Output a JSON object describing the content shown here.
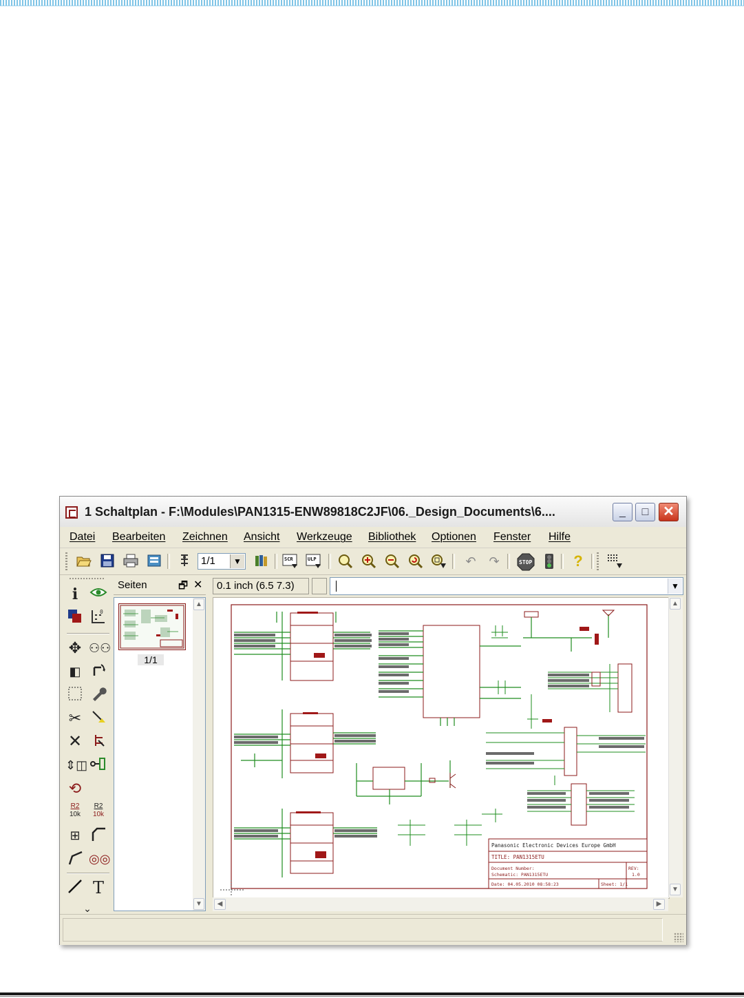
{
  "window": {
    "title": "1 Schaltplan - F:\\Modules\\PAN1315-ENW89818C2JF\\06._Design_Documents\\6....",
    "minimize": "_",
    "maximize": "□",
    "close": "✕"
  },
  "menu": [
    "Datei",
    "Bearbeiten",
    "Zeichnen",
    "Ansicht",
    "Werkzeuge",
    "Bibliothek",
    "Optionen",
    "Fenster",
    "Hilfe"
  ],
  "toolbar": {
    "sheet_value": "1/1",
    "icons": [
      "open-icon",
      "save-icon",
      "print-icon",
      "cam-icon",
      "sheet-icon",
      "library-icon",
      "script-icon",
      "ulp-icon",
      "zoom-fit-icon",
      "zoom-in-icon",
      "zoom-out-icon",
      "zoom-redraw-icon",
      "zoom-select-icon",
      "undo-icon",
      "redo-icon",
      "stop-icon",
      "go-icon",
      "help-icon",
      "grid-icon"
    ],
    "script_label": "SCR",
    "ulp_label": "ULP",
    "stop_label": "STOP",
    "help_label": "?"
  },
  "sidebar_tools": [
    "info-icon",
    "show-icon",
    "display-icon",
    "mark-icon",
    "move-icon",
    "copy-icon",
    "mirror-icon",
    "rotate-icon",
    "group-icon",
    "change-icon",
    "cut-icon",
    "paste-icon",
    "delete-icon",
    "add-icon",
    "pinswap-icon",
    "gateswap-icon",
    "replace-icon",
    "name-icon",
    "value-icon",
    "smash-icon",
    "miter-icon",
    "split-icon",
    "invoke-icon",
    "wire-icon",
    "text-icon",
    "more-icon"
  ],
  "tool_labels": {
    "name_top": "R2",
    "name_bottom": "10k",
    "text": "T"
  },
  "pages_panel": {
    "title": "Seiten",
    "restore": "🗗",
    "close": "✕",
    "page_label": "1/1"
  },
  "coords": "0.1 inch (6.5 7.3)",
  "command_line": "",
  "titleblock": {
    "company": "Panasonic Electronic Devices Europe GmbH",
    "title": "TITLE:  PAN1315ETU",
    "doc_number": "Document Number:",
    "schematic": "Schematic: PAN1315ETU",
    "rev": "REV:",
    "rev_value": "1.0",
    "date": "Date: 04.05.2010 08:58:23",
    "sheet": "Sheet: 1/1"
  },
  "colors": {
    "frame": "#8b1a1a",
    "net": "#1e8c1e",
    "bus": "#6b6b6b",
    "part_fill": "#a01818",
    "window_bg": "#ece9d8",
    "close_button": "#c8341c"
  }
}
